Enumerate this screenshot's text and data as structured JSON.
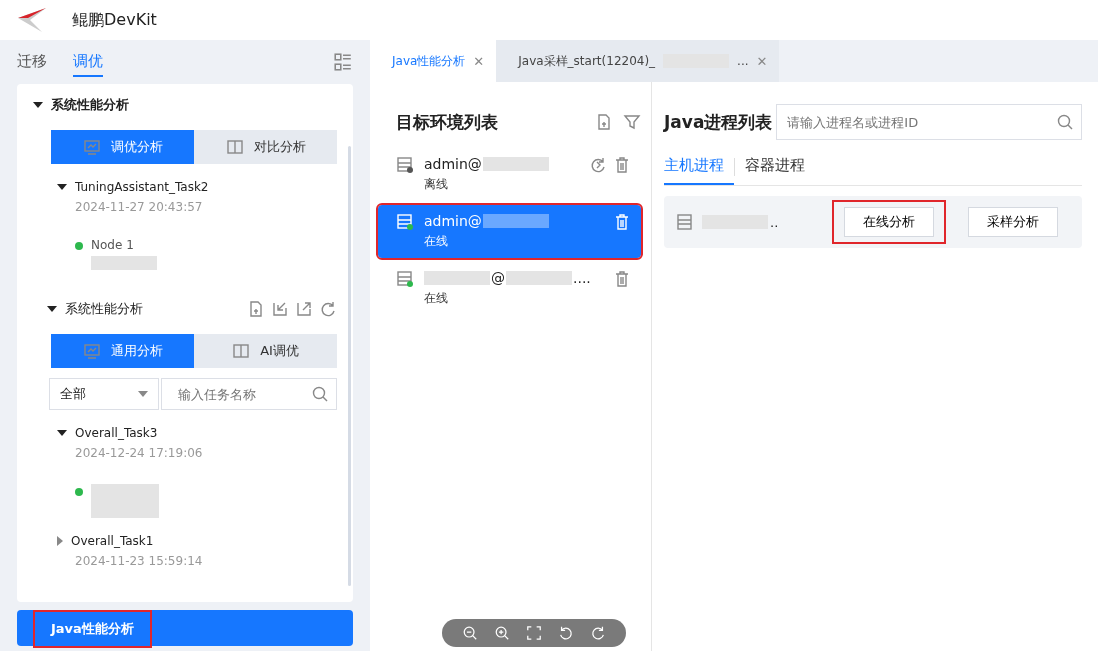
{
  "app": {
    "title": "鲲鹏DevKit"
  },
  "nav_tabs": [
    {
      "label": "迁移",
      "selected": false
    },
    {
      "label": "调优",
      "selected": true
    }
  ],
  "sections": [
    {
      "title": "系统性能分析",
      "expanded": true,
      "toolbar": false,
      "toggle": [
        {
          "label": "调优分析",
          "selected": true
        },
        {
          "label": "对比分析",
          "selected": false
        }
      ],
      "tasks": [
        {
          "name": "TuningAssistant_Task2",
          "date": "2024-11-27 20:43:57",
          "expanded": true,
          "nodes": [
            {
              "parts": [
                {
                  "kind": "text",
                  "text": "Node 1"
                },
                {
                  "kind": "redacted"
                }
              ],
              "color": "#2db84d"
            }
          ]
        }
      ]
    },
    {
      "title": "系统性能分析",
      "expanded": true,
      "toolbar": true,
      "toggle": [
        {
          "label": "通用分析",
          "selected": true
        },
        {
          "label": "AI调优",
          "selected": false
        }
      ],
      "filter": {
        "value": "全部",
        "placeholder": "输入任务名称"
      },
      "tasks": [
        {
          "name": "Overall_Task3",
          "date": "2024-12-24 17:19:06",
          "expanded": true,
          "nodes": [
            {
              "parts": [
                {
                  "kind": "redacted"
                }
              ],
              "color": "#2db84d"
            }
          ]
        },
        {
          "name": "Overall_Task1",
          "date": "2024-11-23 15:59:14",
          "expanded": false
        }
      ]
    }
  ],
  "bottom_button": {
    "label": "Java性能分析",
    "highlighted": true
  },
  "doc_tabs": [
    {
      "parts": [
        {
          "kind": "text",
          "text": "Java性能分析"
        }
      ],
      "close": "✕",
      "selected": true
    },
    {
      "parts": [
        {
          "kind": "text",
          "text": "Java采样_start(12204)_"
        },
        {
          "kind": "redacted"
        },
        {
          "kind": "text",
          "text": "..."
        }
      ],
      "close": "✕",
      "selected": false
    }
  ],
  "targets": {
    "title": "目标环境列表",
    "items": [
      {
        "parts": [
          {
            "kind": "text",
            "text": "admin@"
          },
          {
            "kind": "redacted"
          }
        ],
        "status": "离线",
        "online": false,
        "refresh": true,
        "selected": false,
        "highlighted": false
      },
      {
        "parts": [
          {
            "kind": "text",
            "text": "admin@"
          },
          {
            "kind": "redacted"
          }
        ],
        "status": "在线",
        "online": true,
        "refresh": false,
        "selected": true,
        "highlighted": true
      },
      {
        "parts": [
          {
            "kind": "redacted"
          },
          {
            "kind": "text",
            "text": "@"
          },
          {
            "kind": "redacted"
          },
          {
            "kind": "text",
            "text": "...."
          }
        ],
        "status": "在线",
        "online": true,
        "refresh": false,
        "selected": false,
        "highlighted": false
      }
    ]
  },
  "processes": {
    "title": "Java进程列表",
    "search_placeholder": "请输入进程名或进程ID",
    "tabs": [
      {
        "label": "主机进程",
        "selected": true
      },
      {
        "label": "容器进程",
        "selected": false
      }
    ],
    "rows": [
      {
        "parts": [
          {
            "kind": "redacted"
          },
          {
            "kind": "text",
            "text": ".."
          }
        ],
        "buttons": [
          {
            "label": "在线分析",
            "highlighted": true
          },
          {
            "label": "采样分析",
            "highlighted": false
          }
        ]
      }
    ]
  }
}
